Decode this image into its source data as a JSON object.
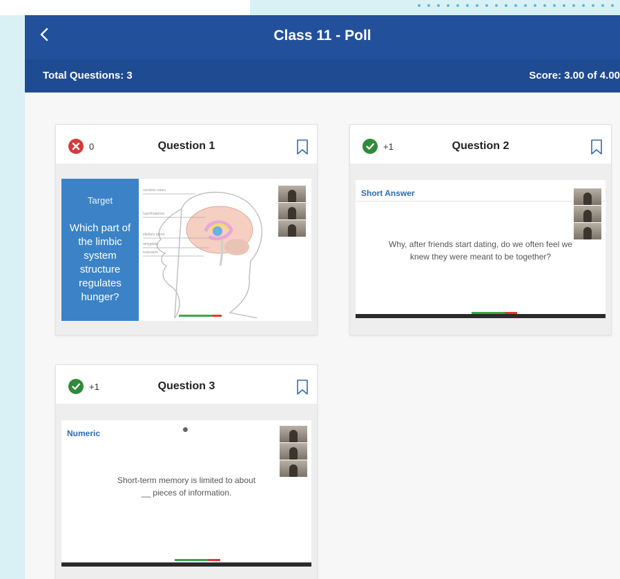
{
  "header": {
    "title": "Class 11 - Poll",
    "back_icon": "chevron-left-icon"
  },
  "summary": {
    "total_questions": "Total Questions: 3",
    "score": "Score: 3.00 of 4.00"
  },
  "questions": [
    {
      "title": "Question 1",
      "status": "incorrect",
      "status_icon": "x-circle-icon",
      "status_color": "#d63a3a",
      "points": "0",
      "slide": {
        "target_label": "Target",
        "prompt": "Which part of the limbic system structure regulates hunger?"
      }
    },
    {
      "title": "Question 2",
      "status": "correct",
      "status_icon": "check-circle-icon",
      "status_color": "#2e8b3a",
      "points": "+1",
      "slide": {
        "type_label": "Short Answer",
        "prompt": "Why, after friends start dating, do we often feel we knew they were meant to be together?"
      }
    },
    {
      "title": "Question 3",
      "status": "correct",
      "status_icon": "check-circle-icon",
      "status_color": "#2e8b3a",
      "points": "+1",
      "slide": {
        "type_label": "Numeric",
        "prompt": "Short-term memory is limited to about __ pieces of information."
      }
    }
  ],
  "colors": {
    "header": "#23509b",
    "subbar": "#1f4b93",
    "target_panel": "#3b83c6",
    "accent_text": "#2a6cb3"
  }
}
